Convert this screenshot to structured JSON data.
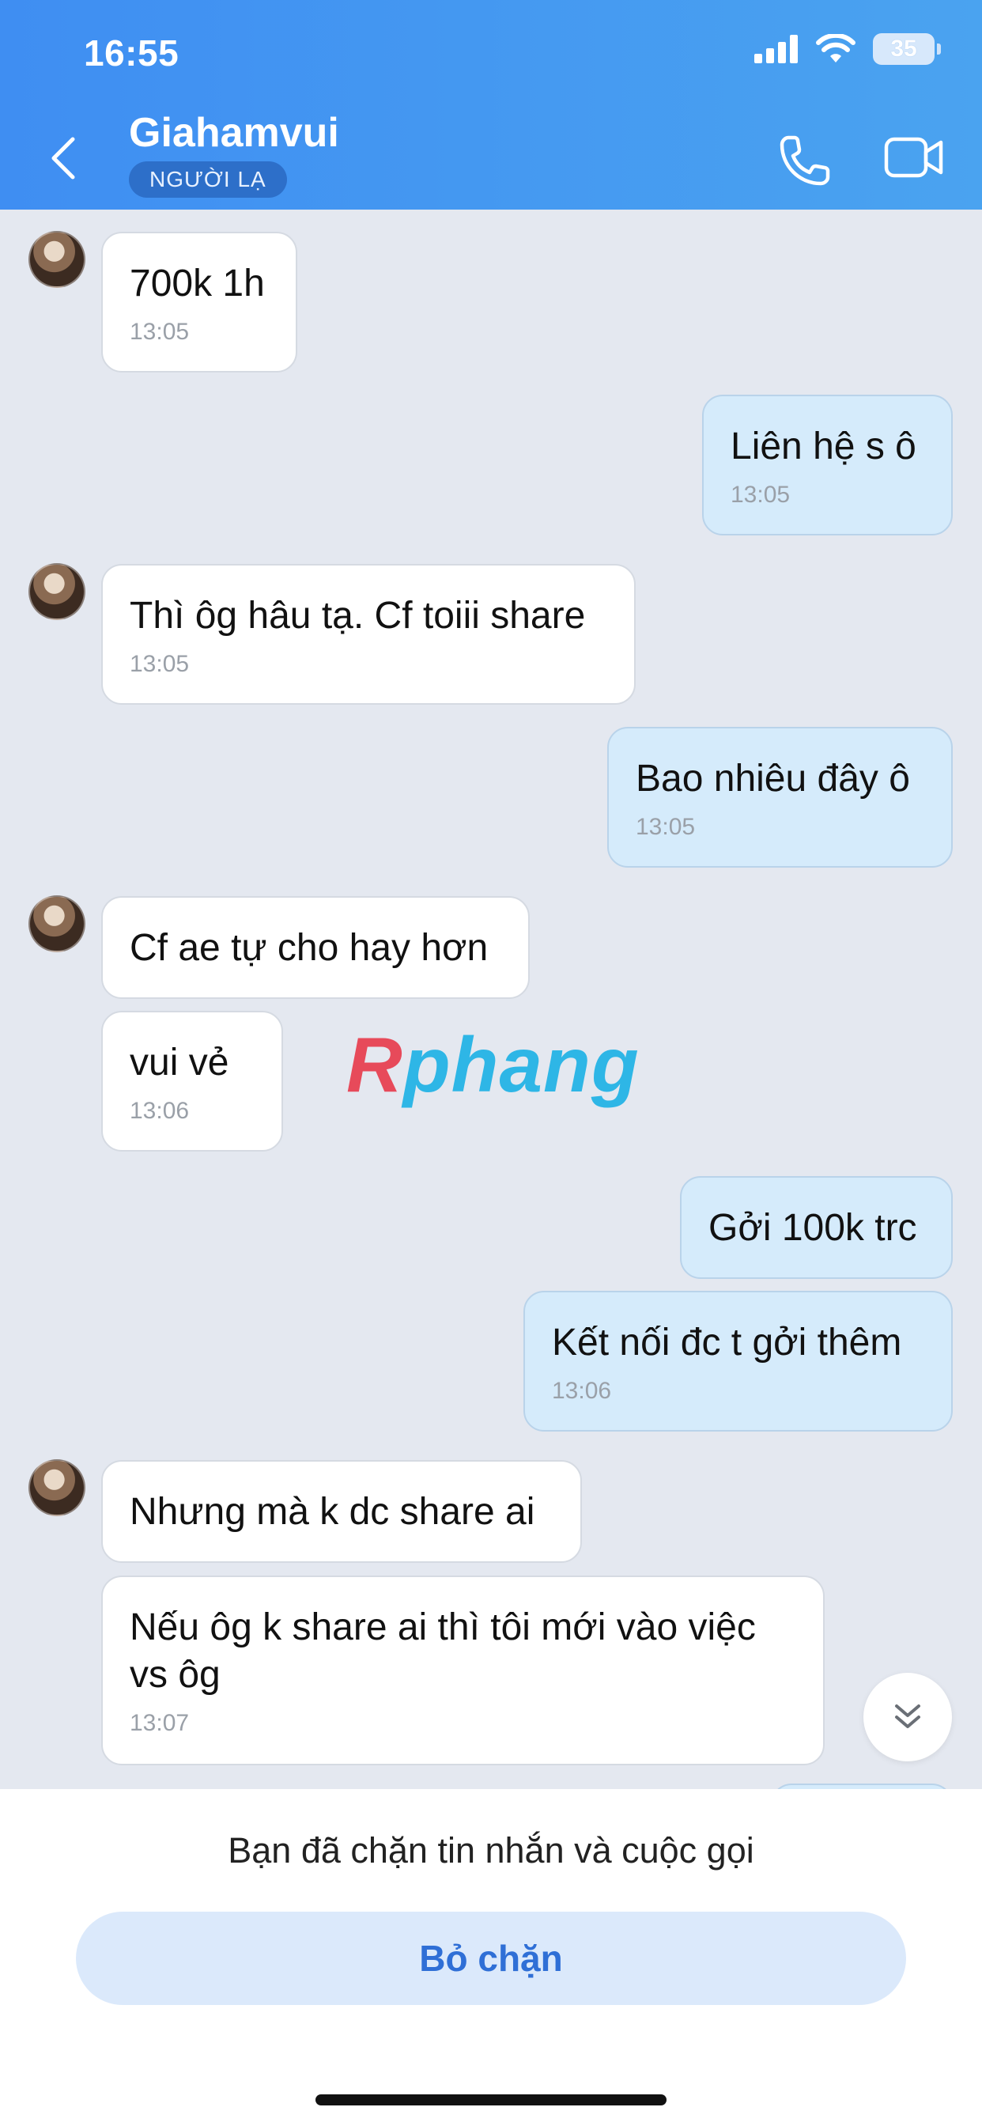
{
  "status_bar": {
    "time": "16:55",
    "battery": "35"
  },
  "header": {
    "contact_name": "Giahamvui",
    "badge": "NGƯỜI LẠ"
  },
  "messages": [
    {
      "text": "700k 1h",
      "time": "13:05"
    },
    {
      "text": "Liên hệ s ô",
      "time": "13:05"
    },
    {
      "text": "Thì ôg hâu tạ. Cf toiii share",
      "time": "13:05"
    },
    {
      "text": "Bao nhiêu đây ô",
      "time": "13:05"
    },
    {
      "text": "Cf ae tự cho hay hơn"
    },
    {
      "text": "vui vẻ",
      "time": "13:06"
    },
    {
      "text": "Gởi 100k trc"
    },
    {
      "text": "Kết nối đc t gởi thêm",
      "time": "13:06"
    },
    {
      "text": "Nhưng mà k dc share ai"
    },
    {
      "text": "Nếu ôg k share ai thì tôi mới vào việc vs ôg",
      "time": "13:07"
    }
  ],
  "watermark": {
    "part1": "R",
    "part2": "phang"
  },
  "footer": {
    "blocked_notice": "Bạn đã chặn tin nhắn và cuộc gọi",
    "unblock_label": "Bỏ chặn"
  },
  "colors": {
    "header_start": "#3f8ef2",
    "header_end": "#4aa3f0",
    "incoming_bubble": "#ffffff",
    "outgoing_bubble": "#d5ebfb",
    "chat_bg": "#e4e8f0",
    "accent": "#2f6fd6"
  },
  "icons": [
    "back-arrow-icon",
    "phone-icon",
    "video-camera-icon",
    "signal-icon",
    "wifi-icon",
    "battery-icon",
    "chevron-double-down-icon"
  ]
}
